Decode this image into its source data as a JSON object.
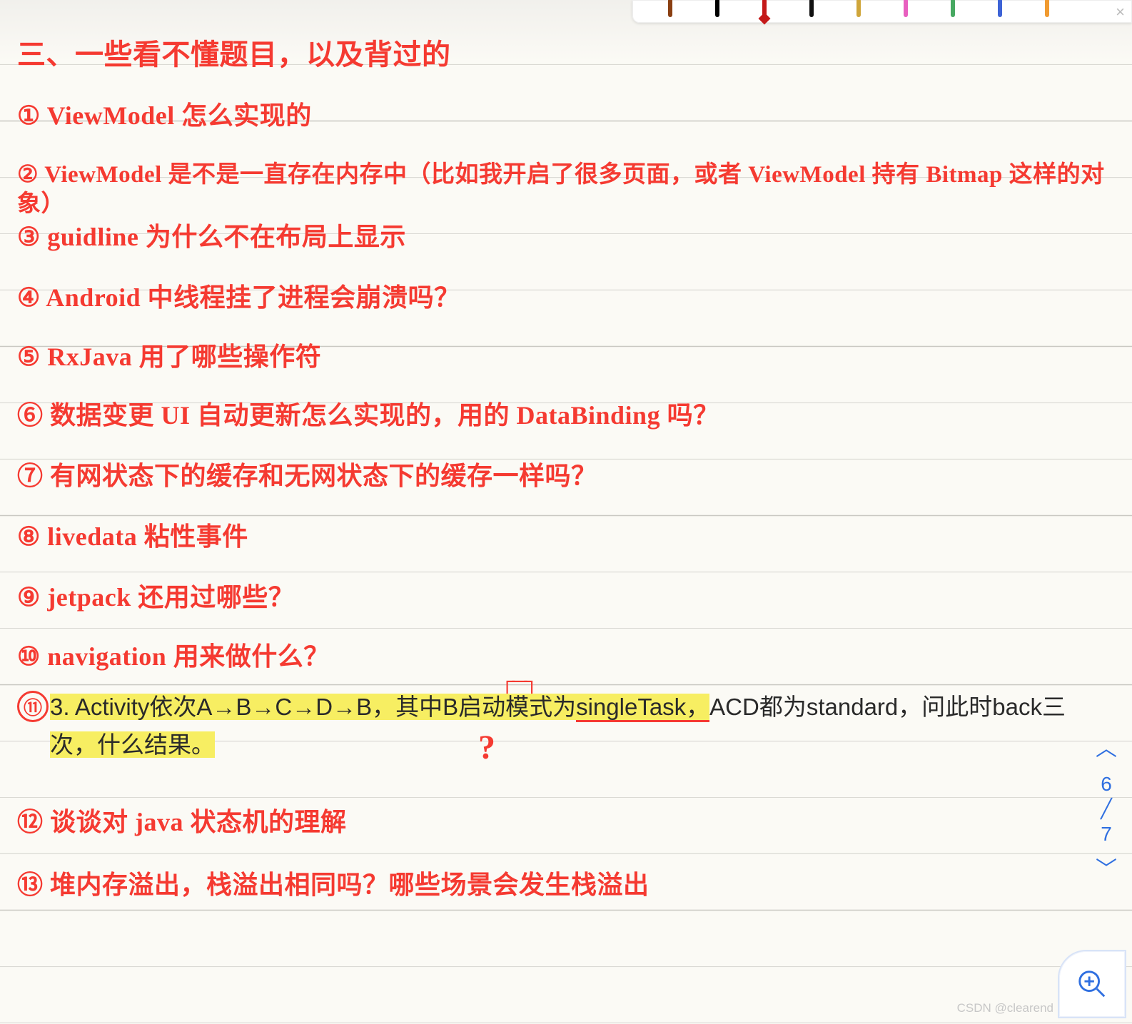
{
  "toolbar": {
    "colors": [
      "#8a3f12",
      "#000000",
      "#c41919",
      "#111111",
      "#cfa53a",
      "#e85fbf",
      "#47a861",
      "#3d63d6",
      "#f09a30"
    ],
    "active_index": 2,
    "close_label": "×"
  },
  "notes": {
    "section_title": "三、一些看不懂题目，以及背过的",
    "items": [
      "① ViewModel 怎么实现的",
      "② ViewModel 是不是一直存在内存中（比如我开启了很多页面，或者 ViewModel 持有 Bitmap 这样的对象）",
      "③ guidline 为什么不在布局上显示",
      "④ Android 中线程挂了进程会崩溃吗？",
      "⑤ RxJava 用了哪些操作符",
      "⑥ 数据变更 UI 自动更新怎么实现的，用的 DataBinding 吗？",
      "⑦ 有网状态下的缓存和无网状态下的缓存一样吗？",
      "⑧ livedata 粘性事件",
      "⑨ jetpack 还用过哪些？",
      "⑩ navigation 用来做什么？"
    ],
    "pasted_question": {
      "circle_number": "⑪",
      "segments": {
        "p1a": "3.   ",
        "p1b": "Activity依次A→B→C→D→B，其中B启动模式为",
        "p1c": "singleTask，",
        "p1d": "ACD都为standard，问此时back三",
        "p2a_hl": "次，什么结果。",
        "p2b": ""
      },
      "marks": {
        "bracket": "┌─┐",
        "question_mark": "?"
      }
    },
    "tail_items": [
      "⑫ 谈谈对 java 状态机的理解",
      "⑬ 堆内存溢出，栈溢出相同吗？哪些场景会发生栈溢出"
    ]
  },
  "pager": {
    "up": "︿",
    "current": "6",
    "total": "7",
    "down": "﹀"
  },
  "fab": {
    "name": "zoom-in"
  },
  "watermark": "CSDN @clearend"
}
